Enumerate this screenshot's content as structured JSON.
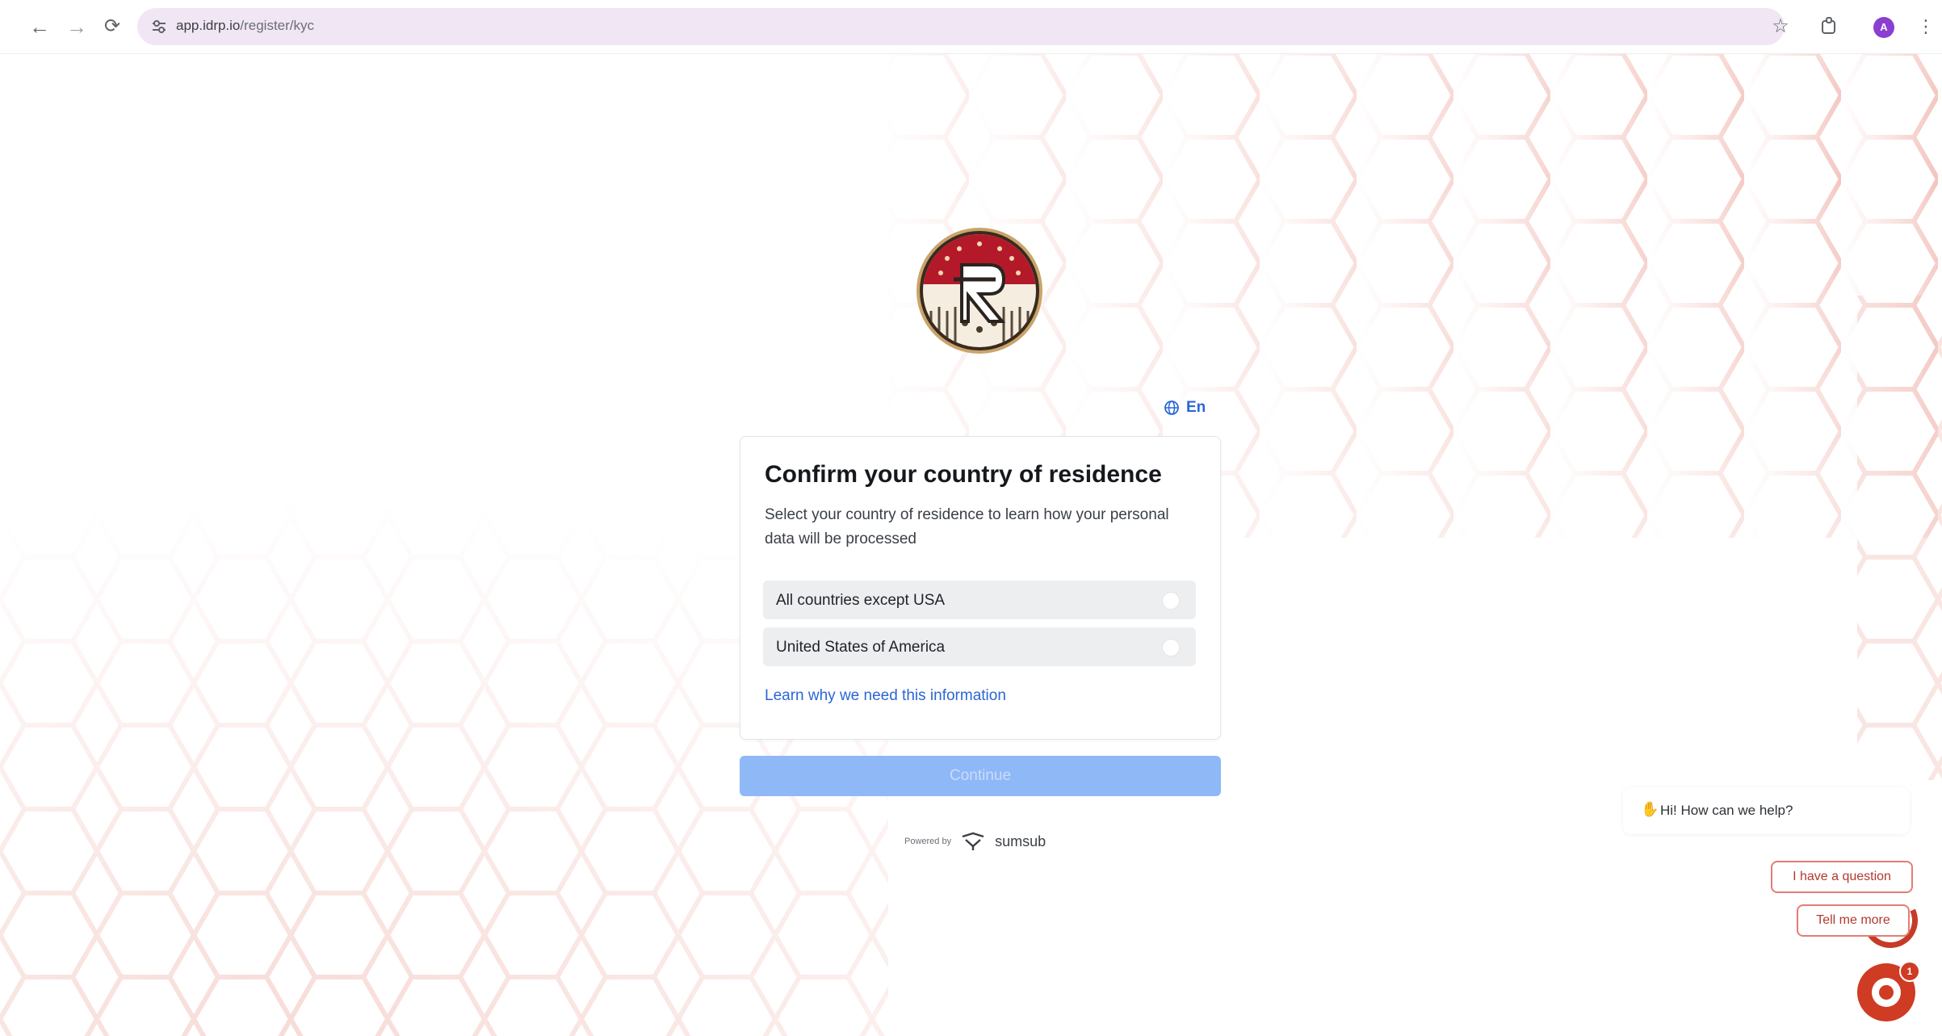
{
  "browser": {
    "url_host": "app.idrp.io",
    "url_path": "/register/kyc",
    "profile_initial": "A",
    "icons": [
      "back-arrow-icon",
      "forward-arrow-icon",
      "reload-icon",
      "site-settings-icon",
      "bookmark-star-icon",
      "extensions-icon",
      "menu-kebab-icon"
    ]
  },
  "page": {
    "language_label": "En",
    "card": {
      "title": "Confirm your country of residence",
      "description": "Select your country of residence to learn how your personal data will be processed",
      "options": [
        {
          "label": "All countries except USA",
          "selected": false
        },
        {
          "label": "United States of America",
          "selected": false
        }
      ],
      "learn_link": "Learn why we need this information"
    },
    "continue_label": "Continue",
    "powered_by": "Powered by",
    "brand": "sumsub"
  },
  "chat": {
    "greeting": "Hi! How can we help?",
    "chips": [
      "I have a question",
      "Tell me more"
    ],
    "badge_count": "1"
  },
  "colors": {
    "accent": "#2b66d6",
    "continue_disabled": "#8fb8f7",
    "chat_red": "#cf3b23",
    "hex_stroke": "#f3c6c0"
  }
}
